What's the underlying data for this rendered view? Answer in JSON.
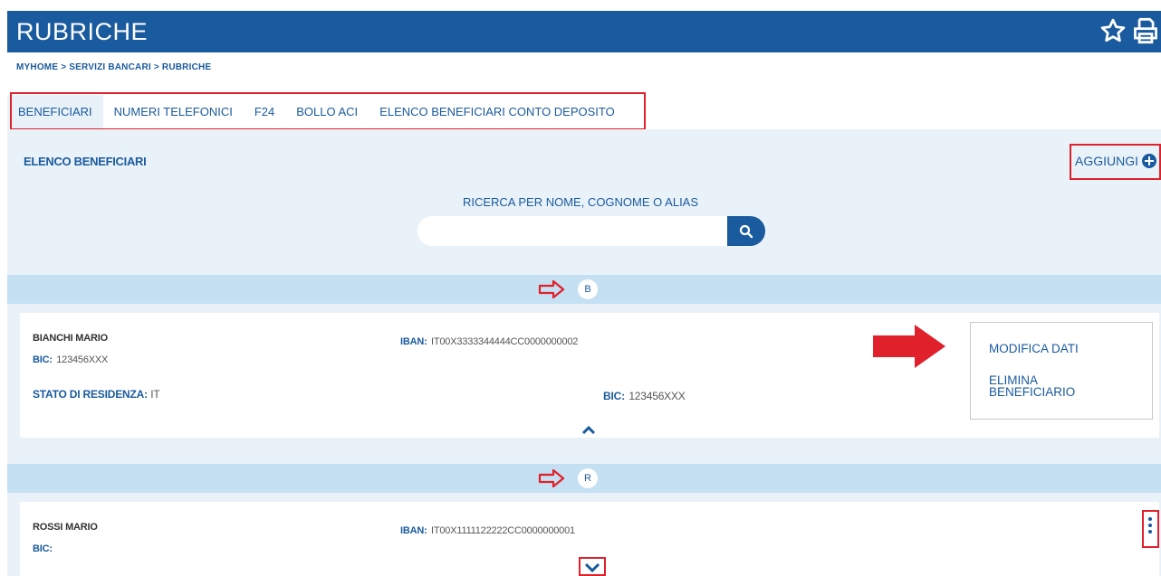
{
  "header": {
    "title": "RUBRICHE",
    "favorite_icon": "star-icon",
    "print_icon": "printer-icon"
  },
  "breadcrumb": [
    "MYHOME",
    ">",
    "SERVIZI BANCARI",
    ">",
    "RUBRICHE"
  ],
  "tabs": [
    {
      "label": "BENEFICIARI",
      "active": true
    },
    {
      "label": "NUMERI TELEFONICI",
      "active": false
    },
    {
      "label": "F24",
      "active": false
    },
    {
      "label": "BOLLO ACI",
      "active": false
    },
    {
      "label": "ELENCO BENEFICIARI CONTO DEPOSITO",
      "active": false
    }
  ],
  "list": {
    "title": "ELENCO BENEFICIARI",
    "add_label": "AGGIUNGI",
    "search_label": "RICERCA PER NOME, COGNOME O ALIAS",
    "search_value": ""
  },
  "groups": [
    {
      "letter": "B",
      "entries": [
        {
          "name": "BIANCHI MARIO",
          "bic_label": "BIC:",
          "bic": "123456XXX",
          "iban_label": "IBAN:",
          "iban": "IT00X3333344444CC0000000002",
          "stato_label": "STATO DI RESIDENZA:",
          "stato": "IT",
          "bic2_label": "BIC:",
          "bic2": "123456XXX",
          "expanded": true
        }
      ]
    },
    {
      "letter": "R",
      "entries": [
        {
          "name": "ROSSI MARIO",
          "bic_label": "BIC:",
          "bic": "",
          "iban_label": "IBAN:",
          "iban": "IT00X1111122222CC0000000001",
          "expanded": false
        }
      ]
    }
  ],
  "context_menu": {
    "items": [
      "MODIFICA DATI",
      "ELIMINA BENEFICIARIO"
    ]
  },
  "colors": {
    "brand": "#1a5a9e",
    "panel": "#eaf2f9",
    "letter_bar": "#c5dff3",
    "highlight": "#e0202a"
  }
}
